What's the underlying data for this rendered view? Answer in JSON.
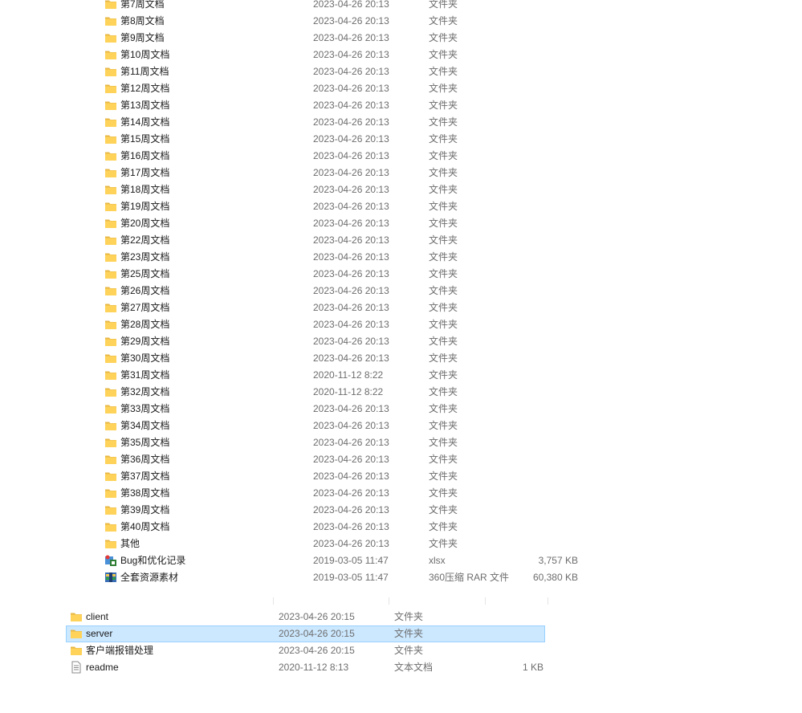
{
  "upper_list": [
    {
      "name": "第7周文档",
      "date": "2023-04-26 20:13",
      "type": "文件夹",
      "size": "",
      "icon": "folder-icon"
    },
    {
      "name": "第8周文档",
      "date": "2023-04-26 20:13",
      "type": "文件夹",
      "size": "",
      "icon": "folder-icon"
    },
    {
      "name": "第9周文档",
      "date": "2023-04-26 20:13",
      "type": "文件夹",
      "size": "",
      "icon": "folder-icon"
    },
    {
      "name": "第10周文档",
      "date": "2023-04-26 20:13",
      "type": "文件夹",
      "size": "",
      "icon": "folder-icon"
    },
    {
      "name": "第11周文档",
      "date": "2023-04-26 20:13",
      "type": "文件夹",
      "size": "",
      "icon": "folder-icon"
    },
    {
      "name": "第12周文档",
      "date": "2023-04-26 20:13",
      "type": "文件夹",
      "size": "",
      "icon": "folder-icon"
    },
    {
      "name": "第13周文档",
      "date": "2023-04-26 20:13",
      "type": "文件夹",
      "size": "",
      "icon": "folder-icon"
    },
    {
      "name": "第14周文档",
      "date": "2023-04-26 20:13",
      "type": "文件夹",
      "size": "",
      "icon": "folder-icon"
    },
    {
      "name": "第15周文档",
      "date": "2023-04-26 20:13",
      "type": "文件夹",
      "size": "",
      "icon": "folder-icon"
    },
    {
      "name": "第16周文档",
      "date": "2023-04-26 20:13",
      "type": "文件夹",
      "size": "",
      "icon": "folder-icon"
    },
    {
      "name": "第17周文档",
      "date": "2023-04-26 20:13",
      "type": "文件夹",
      "size": "",
      "icon": "folder-icon"
    },
    {
      "name": "第18周文档",
      "date": "2023-04-26 20:13",
      "type": "文件夹",
      "size": "",
      "icon": "folder-icon"
    },
    {
      "name": "第19周文档",
      "date": "2023-04-26 20:13",
      "type": "文件夹",
      "size": "",
      "icon": "folder-icon"
    },
    {
      "name": "第20周文档",
      "date": "2023-04-26 20:13",
      "type": "文件夹",
      "size": "",
      "icon": "folder-icon"
    },
    {
      "name": "第22周文档",
      "date": "2023-04-26 20:13",
      "type": "文件夹",
      "size": "",
      "icon": "folder-icon"
    },
    {
      "name": "第23周文档",
      "date": "2023-04-26 20:13",
      "type": "文件夹",
      "size": "",
      "icon": "folder-icon"
    },
    {
      "name": "第25周文档",
      "date": "2023-04-26 20:13",
      "type": "文件夹",
      "size": "",
      "icon": "folder-icon"
    },
    {
      "name": "第26周文档",
      "date": "2023-04-26 20:13",
      "type": "文件夹",
      "size": "",
      "icon": "folder-icon"
    },
    {
      "name": "第27周文档",
      "date": "2023-04-26 20:13",
      "type": "文件夹",
      "size": "",
      "icon": "folder-icon"
    },
    {
      "name": "第28周文档",
      "date": "2023-04-26 20:13",
      "type": "文件夹",
      "size": "",
      "icon": "folder-icon"
    },
    {
      "name": "第29周文档",
      "date": "2023-04-26 20:13",
      "type": "文件夹",
      "size": "",
      "icon": "folder-icon"
    },
    {
      "name": "第30周文档",
      "date": "2023-04-26 20:13",
      "type": "文件夹",
      "size": "",
      "icon": "folder-icon"
    },
    {
      "name": "第31周文档",
      "date": "2020-11-12 8:22",
      "type": "文件夹",
      "size": "",
      "icon": "folder-icon"
    },
    {
      "name": "第32周文档",
      "date": "2020-11-12 8:22",
      "type": "文件夹",
      "size": "",
      "icon": "folder-icon"
    },
    {
      "name": "第33周文档",
      "date": "2023-04-26 20:13",
      "type": "文件夹",
      "size": "",
      "icon": "folder-icon"
    },
    {
      "name": "第34周文档",
      "date": "2023-04-26 20:13",
      "type": "文件夹",
      "size": "",
      "icon": "folder-icon"
    },
    {
      "name": "第35周文档",
      "date": "2023-04-26 20:13",
      "type": "文件夹",
      "size": "",
      "icon": "folder-icon"
    },
    {
      "name": "第36周文档",
      "date": "2023-04-26 20:13",
      "type": "文件夹",
      "size": "",
      "icon": "folder-icon"
    },
    {
      "name": "第37周文档",
      "date": "2023-04-26 20:13",
      "type": "文件夹",
      "size": "",
      "icon": "folder-icon"
    },
    {
      "name": "第38周文档",
      "date": "2023-04-26 20:13",
      "type": "文件夹",
      "size": "",
      "icon": "folder-icon"
    },
    {
      "name": "第39周文档",
      "date": "2023-04-26 20:13",
      "type": "文件夹",
      "size": "",
      "icon": "folder-icon"
    },
    {
      "name": "第40周文档",
      "date": "2023-04-26 20:13",
      "type": "文件夹",
      "size": "",
      "icon": "folder-icon"
    },
    {
      "name": "其他",
      "date": "2023-04-26 20:13",
      "type": "文件夹",
      "size": "",
      "icon": "folder-icon"
    },
    {
      "name": "Bug和优化记录",
      "date": "2019-03-05 11:47",
      "type": "xlsx",
      "size": "3,757 KB",
      "icon": "xlsx-file-icon"
    },
    {
      "name": "全套资源素材",
      "date": "2019-03-05 11:47",
      "type": "360压缩 RAR 文件",
      "size": "60,380 KB",
      "icon": "rar-archive-icon"
    }
  ],
  "lower_list": [
    {
      "name": "client",
      "date": "2023-04-26 20:15",
      "type": "文件夹",
      "size": "",
      "icon": "folder-icon",
      "selected": false
    },
    {
      "name": "server",
      "date": "2023-04-26 20:15",
      "type": "文件夹",
      "size": "",
      "icon": "folder-icon",
      "selected": true
    },
    {
      "name": "客户端报错处理",
      "date": "2023-04-26 20:15",
      "type": "文件夹",
      "size": "",
      "icon": "folder-icon",
      "selected": false
    },
    {
      "name": "readme",
      "date": "2020-11-12 8:13",
      "type": "文本文档",
      "size": "1 KB",
      "icon": "text-file-icon",
      "selected": false
    }
  ],
  "colors": {
    "folder": "#ffd35a",
    "folder_dark": "#e7b745",
    "selection_bg": "#cce8ff",
    "selection_border": "#99d1ff",
    "meta_text": "#6d6d6d"
  }
}
